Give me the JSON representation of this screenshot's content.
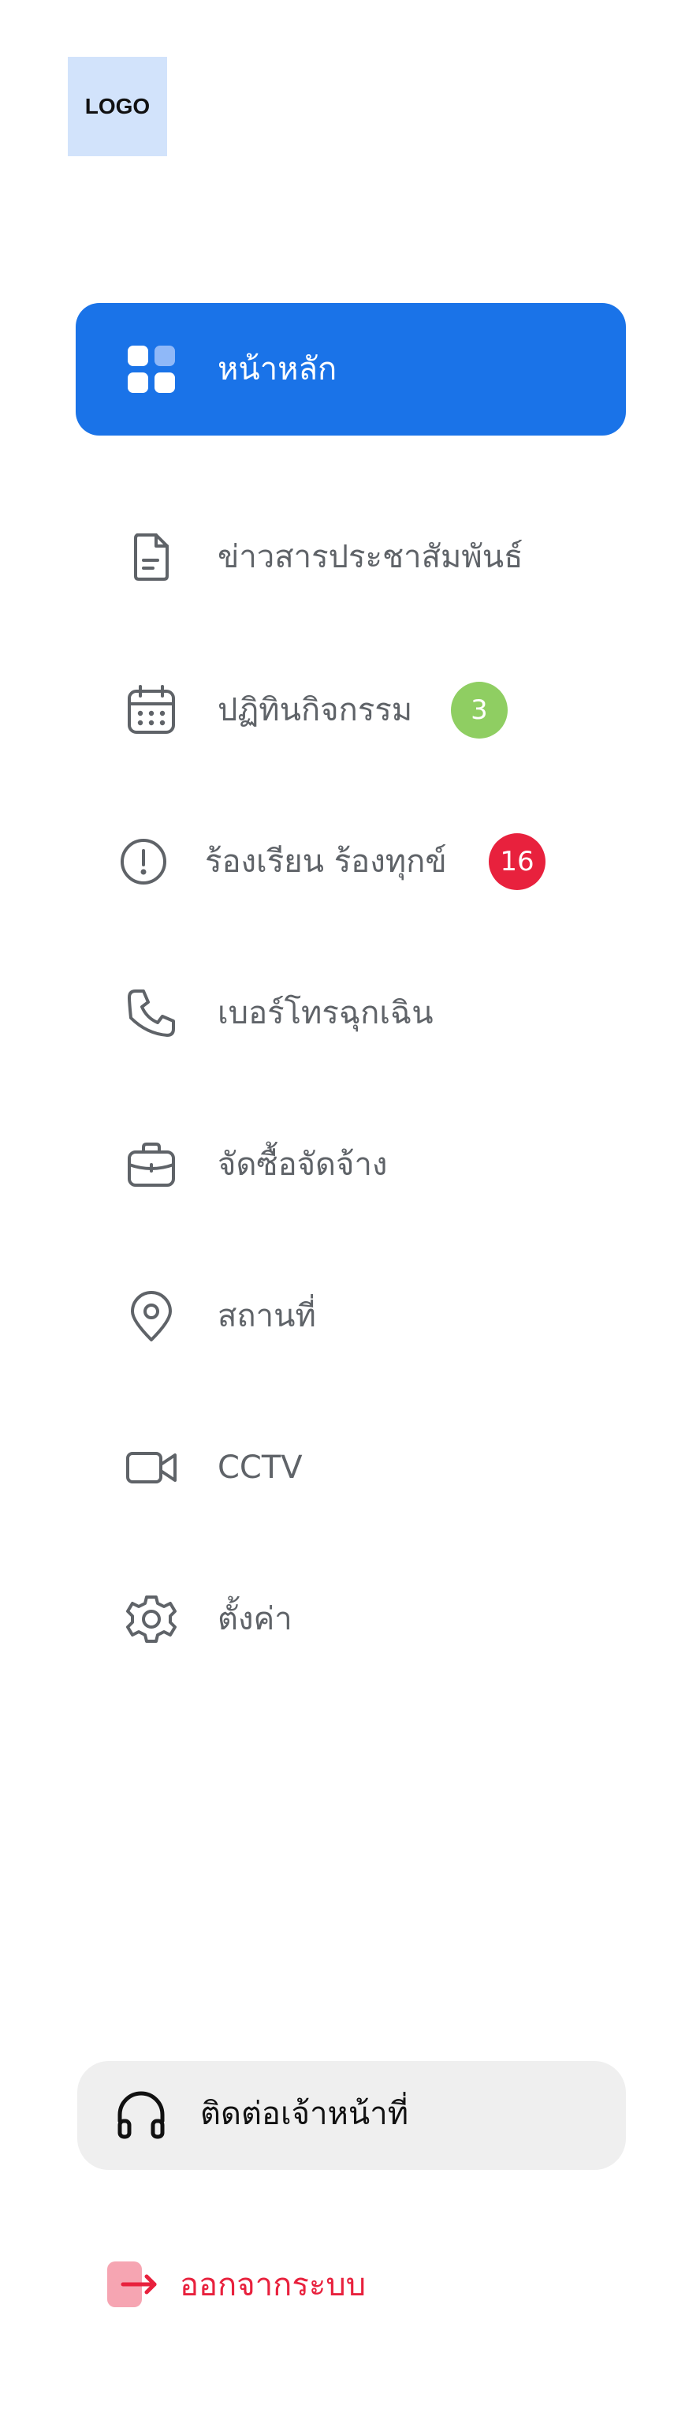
{
  "logo": {
    "text": "LOGO"
  },
  "nav": {
    "items": [
      {
        "label": "หน้าหลัก",
        "icon": "dashboard-icon",
        "active": true
      },
      {
        "label": "ข่าวสารประชาสัมพันธ์",
        "icon": "document-icon"
      },
      {
        "label": "ปฏิทินกิจกรรม",
        "icon": "calendar-icon",
        "badge": "3"
      },
      {
        "label": "ร้องเรียน ร้องทุกข์",
        "icon": "alert-circle-icon",
        "badge": "16"
      },
      {
        "label": "เบอร์โทรฉุกเฉิน",
        "icon": "phone-icon"
      },
      {
        "label": "จัดซื้อจัดจ้าง",
        "icon": "briefcase-icon"
      },
      {
        "label": "สถานที่",
        "icon": "location-pin-icon"
      },
      {
        "label": "CCTV",
        "icon": "video-camera-icon"
      },
      {
        "label": "ตั้งค่า",
        "icon": "gear-icon"
      }
    ]
  },
  "support": {
    "label": "ติดต่อเจ้าหน้าที่",
    "icon": "headphones-icon"
  },
  "logout": {
    "label": "ออกจากระบบ",
    "icon": "logout-arrow-icon"
  },
  "colors": {
    "accent": "#1a73e8",
    "badge_green": "#8fce62",
    "badge_red": "#e8213d",
    "logout": "#e8213d",
    "support_bg": "#efefef"
  }
}
